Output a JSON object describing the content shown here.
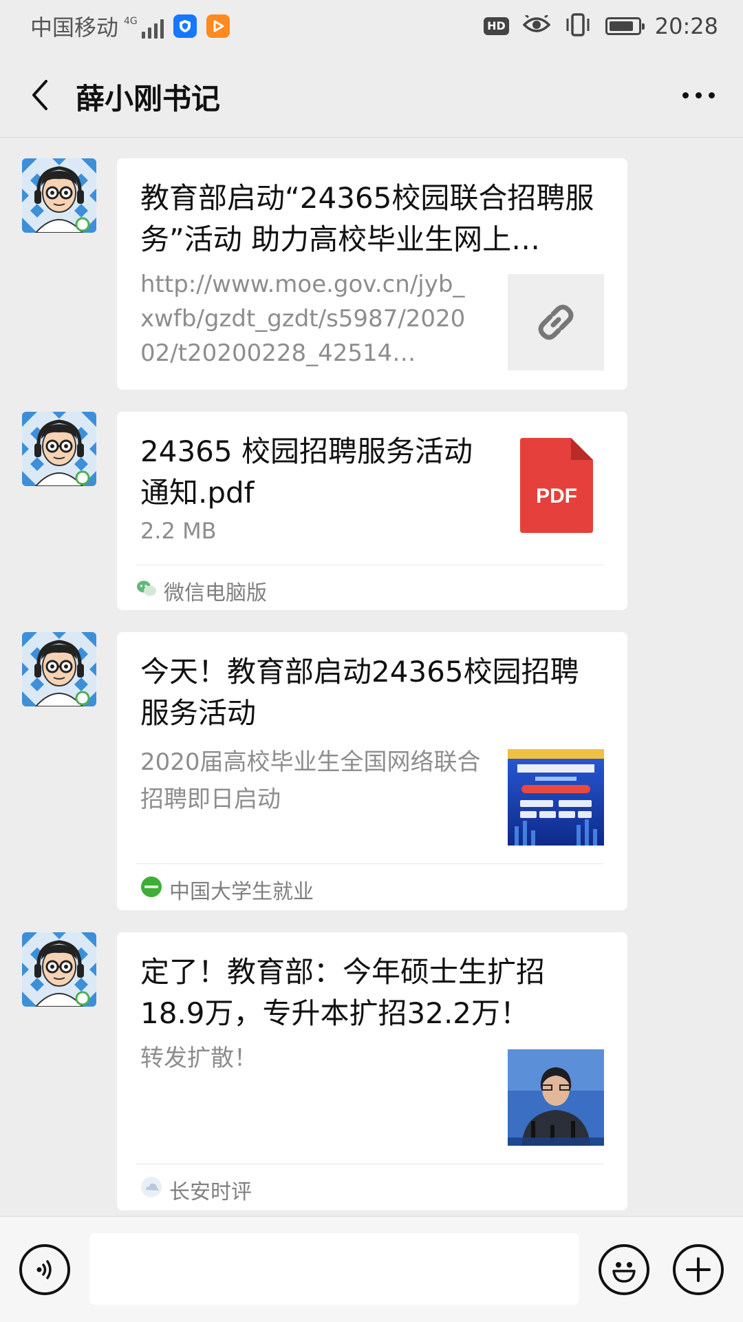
{
  "status_bar": {
    "carrier": "中国移动",
    "network": "4G",
    "time": "20:28",
    "hd_label": "HD",
    "battery_level": 0.85
  },
  "header": {
    "title": "薛小刚书记"
  },
  "messages": [
    {
      "type": "link",
      "title": "教育部启动“24365校园联合招聘服务”活动 助力高校毕业生网上…",
      "desc": "http://www.moe.gov.cn/jyb_xwfb/gzdt_gzdt/s5987/202002/t20200228_42514…",
      "icon": "link-icon"
    },
    {
      "type": "file",
      "title": "24365 校园招聘服务活动通知.pdf",
      "size": "2.2 MB",
      "file_icon_label": "PDF",
      "source": "微信电脑版",
      "source_icon": "wechat-icon"
    },
    {
      "type": "article",
      "title": "今天！教育部启动24365校园招聘服务活动",
      "desc": "2020届高校毕业生全国网络联合招聘即日启动",
      "thumb": "campus-recruit-poster-thumbnail",
      "source": "中国大学生就业",
      "source_icon": "green-circle-logo"
    },
    {
      "type": "article",
      "title": "定了！教育部：今年硕士生扩招18.9万，专升本扩招32.2万！",
      "desc": "转发扩散！",
      "thumb": "press-conference-photo-thumbnail",
      "source": "长安时评",
      "source_icon": "cloud-logo"
    }
  ],
  "colors": {
    "background": "#ededed",
    "card": "#ffffff",
    "pdf_red": "#e5403b",
    "secondary_text": "#8d8d8d"
  }
}
